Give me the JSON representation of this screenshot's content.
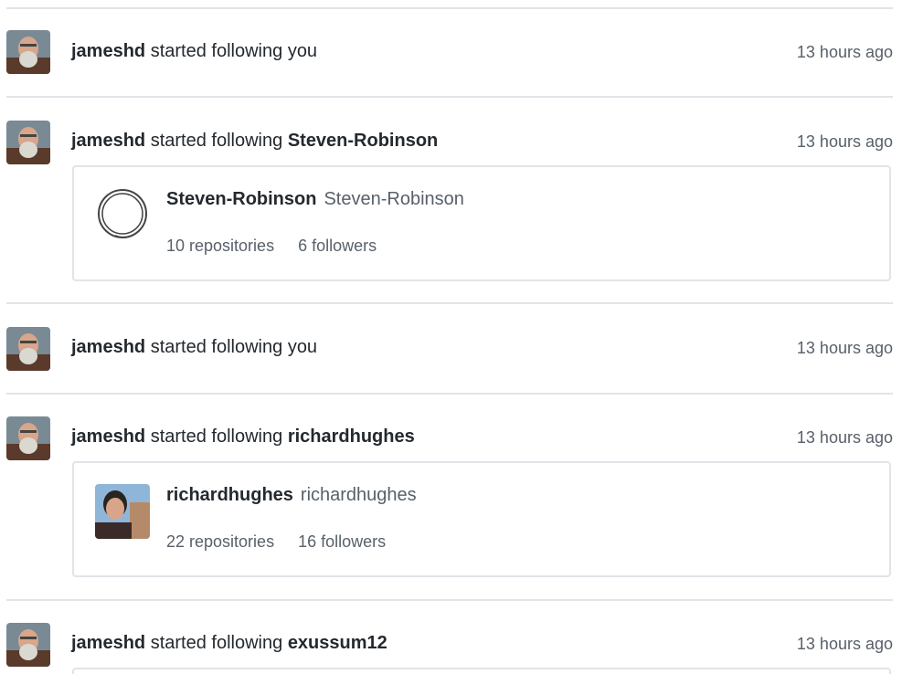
{
  "events": [
    {
      "actor": "jameshd",
      "verb": "started following",
      "target": "you",
      "target_bold": false,
      "time": "13 hours ago"
    },
    {
      "actor": "jameshd",
      "verb": "started following",
      "target": "Steven-Robinson",
      "target_bold": true,
      "time": "13 hours ago",
      "card": {
        "name": "Steven-Robinson",
        "login": "Steven-Robinson",
        "repos": "10 repositories",
        "followers": "6 followers",
        "avatar_icon": "ouroboros-ring-icon"
      }
    },
    {
      "actor": "jameshd",
      "verb": "started following",
      "target": "you",
      "target_bold": false,
      "time": "13 hours ago"
    },
    {
      "actor": "jameshd",
      "verb": "started following",
      "target": "richardhughes",
      "target_bold": true,
      "time": "13 hours ago",
      "card": {
        "name": "richardhughes",
        "login": "richardhughes",
        "repos": "22 repositories",
        "followers": "16 followers",
        "avatar_icon": "user-photo"
      }
    },
    {
      "actor": "jameshd",
      "verb": "started following",
      "target": "exussum12",
      "target_bold": true,
      "time": "13 hours ago"
    }
  ],
  "colors": {
    "text": "#24292e",
    "muted": "#586069",
    "border": "#e1e4e8"
  }
}
